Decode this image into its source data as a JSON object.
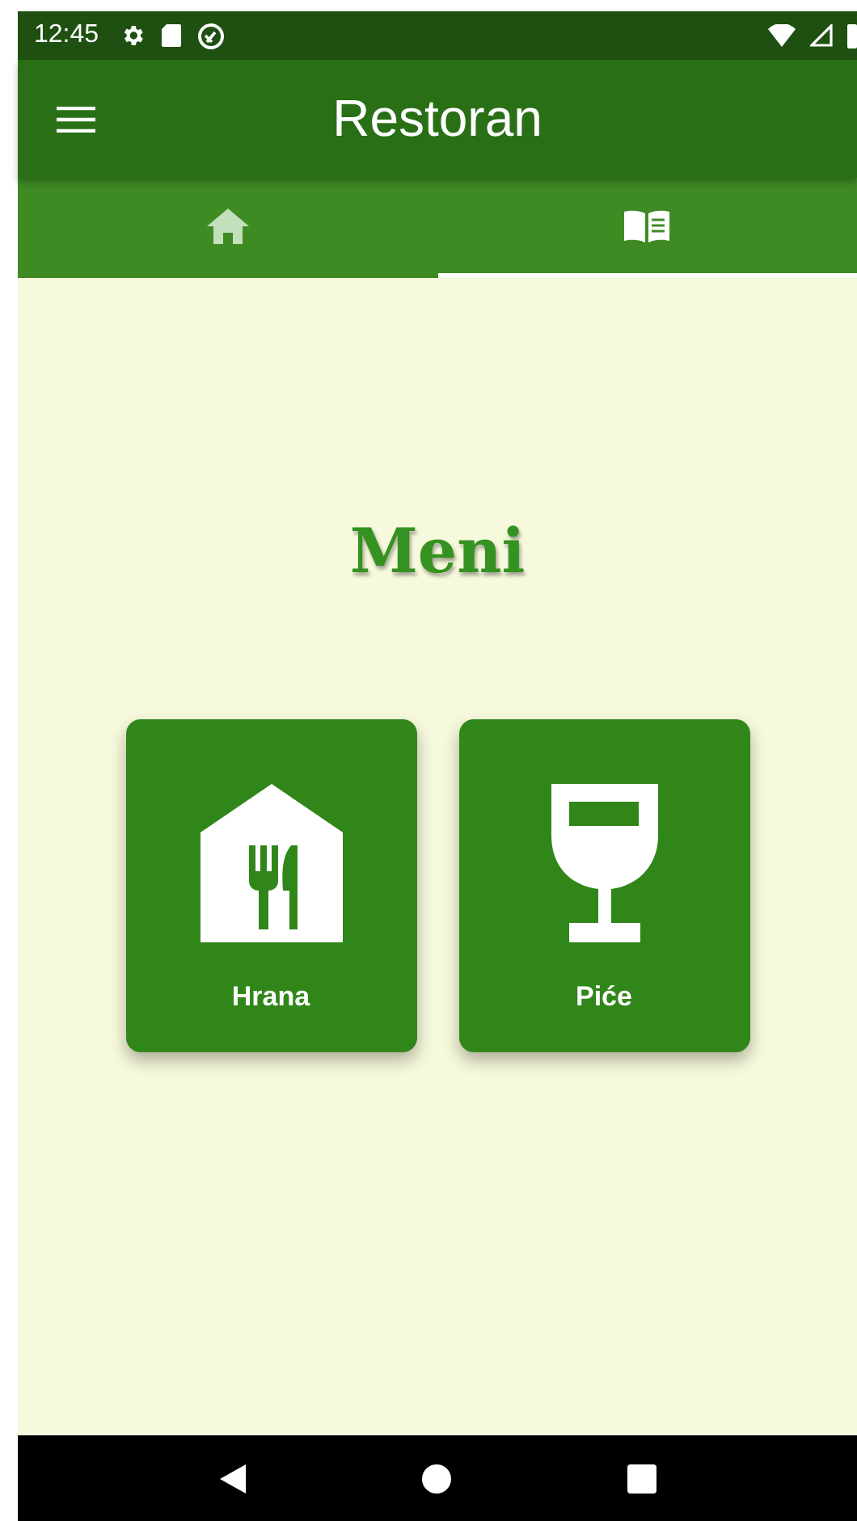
{
  "status_bar": {
    "time": "12:45"
  },
  "app_bar": {
    "title": "Restoran"
  },
  "tabs": [
    {
      "kind": "home",
      "selected": false
    },
    {
      "kind": "menu",
      "selected": true
    }
  ],
  "heading": "Meni",
  "cards": [
    {
      "kind": "food",
      "label": "Hrana"
    },
    {
      "kind": "drink",
      "label": "Piće"
    }
  ]
}
